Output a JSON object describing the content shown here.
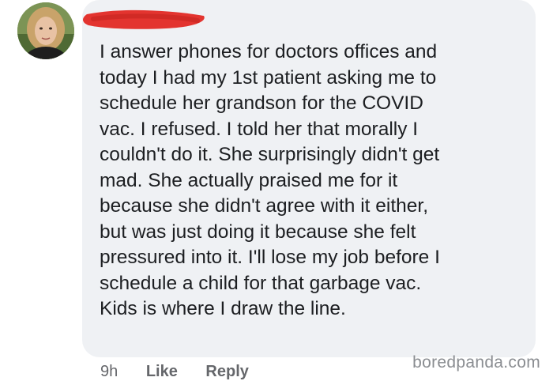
{
  "comment": {
    "author_name": "",
    "author_name_redacted": true,
    "body": "I answer phones for doctors offices and\ntoday I had my 1st patient asking me to\nschedule her grandson for the COVID\nvac. I refused. I told her that morally I\ncouldn't do it. She surprisingly didn't get\nmad. She actually praised me for it\nbecause she didn't agree with it either,\nbut was just doing it because she felt\npressured into it. I'll lose my job before I\nschedule a child for that garbage vac.\nKids is where I draw the line.",
    "timestamp": "9h",
    "like_label": "Like",
    "reply_label": "Reply"
  },
  "watermark": "boredpanda.com",
  "colors": {
    "bubble": "#eff1f4",
    "text": "#1c1e21",
    "meta_text": "#65676b",
    "redaction": "#e3342f",
    "watermark": "#8a8d91"
  },
  "icons": {
    "avatar": "profile-photo"
  }
}
